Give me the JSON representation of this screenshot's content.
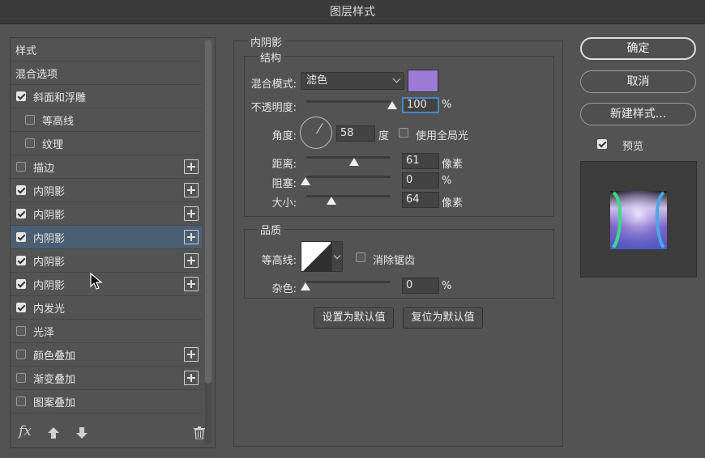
{
  "window": {
    "title": "图层样式"
  },
  "style_list": {
    "items": [
      {
        "label": "样式",
        "type": "header"
      },
      {
        "label": "混合选项",
        "type": "header"
      },
      {
        "label": "斜面和浮雕",
        "checked": true,
        "plus": false,
        "indent": false
      },
      {
        "label": "等高线",
        "checked": false,
        "plus": false,
        "indent": true
      },
      {
        "label": "纹理",
        "checked": false,
        "plus": false,
        "indent": true
      },
      {
        "label": "描边",
        "checked": false,
        "plus": true,
        "indent": false
      },
      {
        "label": "内阴影",
        "checked": true,
        "plus": true,
        "indent": false
      },
      {
        "label": "内阴影",
        "checked": true,
        "plus": true,
        "indent": false
      },
      {
        "label": "内阴影",
        "checked": true,
        "plus": true,
        "indent": false,
        "selected": true
      },
      {
        "label": "内阴影",
        "checked": true,
        "plus": true,
        "indent": false
      },
      {
        "label": "内阴影",
        "checked": true,
        "plus": true,
        "indent": false
      },
      {
        "label": "内发光",
        "checked": true,
        "plus": false,
        "indent": false
      },
      {
        "label": "光泽",
        "checked": false,
        "plus": false,
        "indent": false
      },
      {
        "label": "颜色叠加",
        "checked": false,
        "plus": true,
        "indent": false
      },
      {
        "label": "渐变叠加",
        "checked": false,
        "plus": true,
        "indent": false
      },
      {
        "label": "图案叠加",
        "checked": false,
        "plus": false,
        "indent": false
      }
    ],
    "footer": {
      "fx_label": "fx"
    }
  },
  "inner_shadow": {
    "section_title": "内阴影",
    "structure": {
      "title": "结构",
      "blend_mode_label": "混合模式:",
      "blend_mode_value": "滤色",
      "color": "#9b7bd6",
      "opacity_label": "不透明度:",
      "opacity_value": "100",
      "opacity_unit": "%",
      "angle_label": "角度:",
      "angle_value": "58",
      "angle_unit": "度",
      "global_light_label": "使用全局光",
      "global_light_checked": false,
      "distance_label": "距离:",
      "distance_value": "61",
      "distance_unit": "像素",
      "choke_label": "阻塞:",
      "choke_value": "0",
      "choke_unit": "%",
      "size_label": "大小:",
      "size_value": "64",
      "size_unit": "像素"
    },
    "quality": {
      "title": "品质",
      "contour_label": "等高线:",
      "antialias_label": "消除锯齿",
      "antialias_checked": false,
      "noise_label": "杂色:",
      "noise_value": "0",
      "noise_unit": "%"
    },
    "buttons": {
      "set_default": "设置为默认值",
      "reset_default": "复位为默认值"
    }
  },
  "right_column": {
    "ok": "确定",
    "cancel": "取消",
    "new_style": "新建样式...",
    "preview_label": "预览",
    "preview_checked": true
  }
}
